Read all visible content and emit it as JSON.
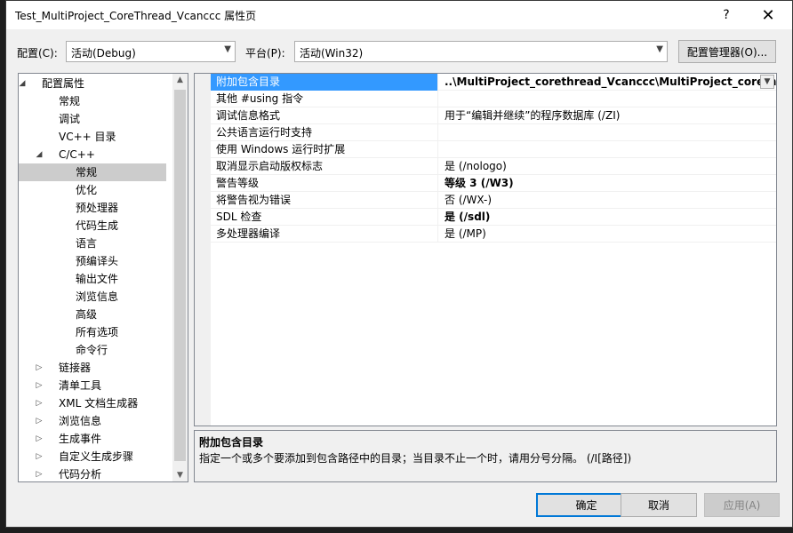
{
  "window": {
    "title": "Test_MultiProject_CoreThread_Vcanccc 属性页",
    "help_glyph": "?",
    "close_glyph": "✕"
  },
  "config": {
    "config_label": "配置(C):",
    "config_value": "活动(Debug)",
    "platform_label": "平台(P):",
    "platform_value": "活动(Win32)",
    "manager_button": "配置管理器(O)..."
  },
  "tree": {
    "items": [
      {
        "label": "配置属性",
        "level": 0,
        "expander": "◢"
      },
      {
        "label": "常规",
        "level": 1,
        "expander": ""
      },
      {
        "label": "调试",
        "level": 1,
        "expander": ""
      },
      {
        "label": "VC++ 目录",
        "level": 1,
        "expander": ""
      },
      {
        "label": "C/C++",
        "level": 1,
        "expander": "◢"
      },
      {
        "label": "常规",
        "level": 2,
        "expander": "",
        "selected": true
      },
      {
        "label": "优化",
        "level": 2,
        "expander": ""
      },
      {
        "label": "预处理器",
        "level": 2,
        "expander": ""
      },
      {
        "label": "代码生成",
        "level": 2,
        "expander": ""
      },
      {
        "label": "语言",
        "level": 2,
        "expander": ""
      },
      {
        "label": "预编译头",
        "level": 2,
        "expander": ""
      },
      {
        "label": "输出文件",
        "level": 2,
        "expander": ""
      },
      {
        "label": "浏览信息",
        "level": 2,
        "expander": ""
      },
      {
        "label": "高级",
        "level": 2,
        "expander": ""
      },
      {
        "label": "所有选项",
        "level": 2,
        "expander": ""
      },
      {
        "label": "命令行",
        "level": 2,
        "expander": ""
      },
      {
        "label": "链接器",
        "level": 1,
        "expander": "▷"
      },
      {
        "label": "清单工具",
        "level": 1,
        "expander": "▷"
      },
      {
        "label": "XML 文档生成器",
        "level": 1,
        "expander": "▷"
      },
      {
        "label": "浏览信息",
        "level": 1,
        "expander": "▷"
      },
      {
        "label": "生成事件",
        "level": 1,
        "expander": "▷"
      },
      {
        "label": "自定义生成步骤",
        "level": 1,
        "expander": "▷"
      },
      {
        "label": "代码分析",
        "level": 1,
        "expander": "▷"
      }
    ]
  },
  "properties": [
    {
      "name": "附加包含目录",
      "value": "..\\MultiProject_corethread_Vcanccc\\MultiProject_corethread_Vcanccc",
      "bold": true,
      "selected": true
    },
    {
      "name": "其他 #using 指令",
      "value": "",
      "bold": false
    },
    {
      "name": "调试信息格式",
      "value": "用于“编辑并继续”的程序数据库 (/ZI)",
      "bold": false
    },
    {
      "name": "公共语言运行时支持",
      "value": "",
      "bold": false
    },
    {
      "name": "使用 Windows 运行时扩展",
      "value": "",
      "bold": false
    },
    {
      "name": "取消显示启动版权标志",
      "value": "是 (/nologo)",
      "bold": false
    },
    {
      "name": "警告等级",
      "value": "等级 3 (/W3)",
      "bold": true
    },
    {
      "name": "将警告视为错误",
      "value": "否 (/WX-)",
      "bold": false
    },
    {
      "name": "SDL 检查",
      "value": "是 (/sdl)",
      "bold": true
    },
    {
      "name": "多处理器编译",
      "value": "是 (/MP)",
      "bold": false
    }
  ],
  "description": {
    "title": "附加包含目录",
    "text": "指定一个或多个要添加到包含路径中的目录；当目录不止一个时，请用分号分隔。    (/I[路径])"
  },
  "buttons": {
    "ok": "确定",
    "cancel": "取消",
    "apply": "应用(A)"
  }
}
